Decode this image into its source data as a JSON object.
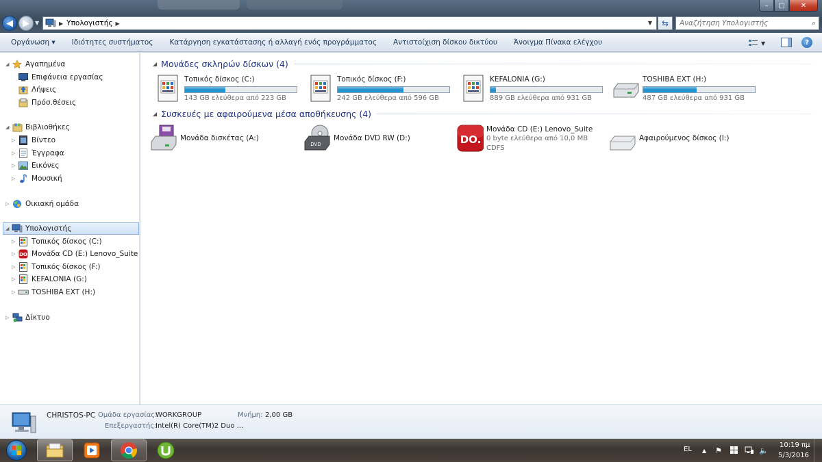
{
  "window": {
    "address_path": "Υπολογιστής",
    "search_placeholder": "Αναζήτηση Υπολογιστής",
    "min": "–",
    "max": "□",
    "close": "✕"
  },
  "toolbar": {
    "organize": "Οργάνωση",
    "system_properties": "Ιδιότητες συστήματος",
    "uninstall": "Κατάργηση εγκατάστασης ή αλλαγή ενός προγράμματος",
    "map_drive": "Αντιστοίχιση δίσκου δικτύου",
    "control_panel": "Άνοιγμα Πίνακα ελέγχου"
  },
  "sidebar": {
    "favorites": "Αγαπημένα",
    "favorites_items": [
      "Επιφάνεια εργασίας",
      "Λήψεις",
      "Πρόσ.θέσεις"
    ],
    "libraries": "Βιβλιοθήκες",
    "libraries_items": [
      "Βίντεο",
      "Έγγραφα",
      "Εικόνες",
      "Μουσική"
    ],
    "homegroup": "Οικιακή ομάδα",
    "computer": "Υπολογιστής",
    "computer_items": [
      "Τοπικός δίσκος (C:)",
      "Μονάδα CD (E:) Lenovo_Suite",
      "Τοπικός δίσκος (F:)",
      "KEFALONIA (G:)",
      "TOSHIBA EXT (H:)"
    ],
    "network": "Δίκτυο"
  },
  "main": {
    "hdd_header": "Μονάδες σκληρών δίσκων (4)",
    "removable_header": "Συσκευές με αφαιρούμενα μέσα αποθήκευσης (4)",
    "hard_drives": [
      {
        "name": "Τοπικός δίσκος (C:)",
        "free": "143 GB ελεύθερα από 223 GB",
        "used_fraction": 0.36
      },
      {
        "name": "Τοπικός δίσκος (F:)",
        "free": "242 GB ελεύθερα από 596 GB",
        "used_fraction": 0.59
      },
      {
        "name": "KEFALONIA (G:)",
        "free": "889 GB ελεύθερα από 931 GB",
        "used_fraction": 0.05
      },
      {
        "name": "TOSHIBA EXT (H:)",
        "free": "487 GB ελεύθερα από 931 GB",
        "used_fraction": 0.48
      }
    ],
    "removable": [
      {
        "name": "Μονάδα δισκέτας (A:)"
      },
      {
        "name": "Μονάδα DVD RW (D:)"
      },
      {
        "name": "Μονάδα CD (E:) Lenovo_Suite",
        "free": "0 byte ελεύθερα από 10,0 MB",
        "fs": "CDFS"
      },
      {
        "name": "Αφαιρούμενος δίσκος (I:)"
      }
    ],
    "dvd_label": "DVD",
    "do_label": "DO."
  },
  "details": {
    "pc_name": "CHRISTOS-PC",
    "workgroup_label": "Ομάδα εργασίας:",
    "workgroup_value": "WORKGROUP",
    "memory_label": "Μνήμη:",
    "memory_value": "2,00 GB",
    "processor_label": "Επεξεργαστής:",
    "processor_value": "Intel(R) Core(TM)2 Duo ..."
  },
  "taskbar": {
    "language": "EL",
    "time": "10:19 πμ",
    "date": "5/3/2016"
  },
  "colors": {
    "accent": "#1e3287",
    "bar_fill": "#1f8dc9",
    "selection": "#cfe2f6"
  }
}
